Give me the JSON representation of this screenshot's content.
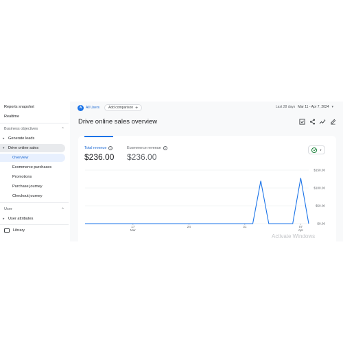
{
  "sidebar": {
    "reports_snapshot": "Reports snapshot",
    "realtime": "Realtime",
    "section_business": "Business objectives",
    "generate_leads": "Generate leads",
    "drive_online_sales": "Drive online sales",
    "subitems": [
      "Overview",
      "Ecommerce purchases",
      "Promotions",
      "Purchase journey",
      "Checkout journey"
    ],
    "section_user": "User",
    "user_attributes": "User attributes",
    "library": "Library"
  },
  "topbar": {
    "avatar_letter": "A",
    "all_users": "All Users",
    "add_comparison": "Add comparison",
    "last_days": "Last 28 days",
    "date_range": "Mar 11 - Apr 7, 2024"
  },
  "page": {
    "title": "Drive online sales overview"
  },
  "icons": {
    "compare": "compare-icon",
    "share": "share-icon",
    "insights": "insights-icon",
    "edit": "edit-icon"
  },
  "metrics": [
    {
      "label": "Total revenue",
      "value": "$236.00"
    },
    {
      "label": "Ecommerce revenue",
      "value": "$236.00"
    }
  ],
  "colors": {
    "accent": "#1a73e8",
    "status_ok": "#188038"
  },
  "chart_data": {
    "type": "line",
    "x": [
      "2024-03-11",
      "2024-03-12",
      "2024-03-13",
      "2024-03-14",
      "2024-03-15",
      "2024-03-16",
      "2024-03-17",
      "2024-03-18",
      "2024-03-19",
      "2024-03-20",
      "2024-03-21",
      "2024-03-22",
      "2024-03-23",
      "2024-03-24",
      "2024-03-25",
      "2024-03-26",
      "2024-03-27",
      "2024-03-28",
      "2024-03-29",
      "2024-03-30",
      "2024-03-31",
      "2024-04-01",
      "2024-04-02",
      "2024-04-03",
      "2024-04-04",
      "2024-04-05",
      "2024-04-06",
      "2024-04-07"
    ],
    "series": [
      {
        "values": [
          0,
          0,
          0,
          0,
          0,
          0,
          0,
          0,
          0,
          0,
          0,
          0,
          0,
          0,
          0,
          0,
          0,
          0,
          0,
          0,
          0,
          0,
          120,
          0,
          0,
          0,
          0,
          128,
          0
        ]
      }
    ],
    "x_ticks": [
      {
        "label": "17",
        "sub": "Mar",
        "x": "2024-03-17"
      },
      {
        "label": "24",
        "sub": "",
        "x": "2024-03-24"
      },
      {
        "label": "31",
        "sub": "",
        "x": "2024-03-31"
      },
      {
        "label": "07",
        "sub": "Apr",
        "x": "2024-04-07"
      }
    ],
    "y_ticks": [
      {
        "label": "$150.00",
        "v": 150
      },
      {
        "label": "$100.00",
        "v": 100
      },
      {
        "label": "$50.00",
        "v": 50
      },
      {
        "label": "$0.00",
        "v": 0
      }
    ],
    "ylim": [
      0,
      150
    ],
    "grid": true,
    "line_color": "#1a73e8"
  },
  "watermark": "Activate Windows"
}
